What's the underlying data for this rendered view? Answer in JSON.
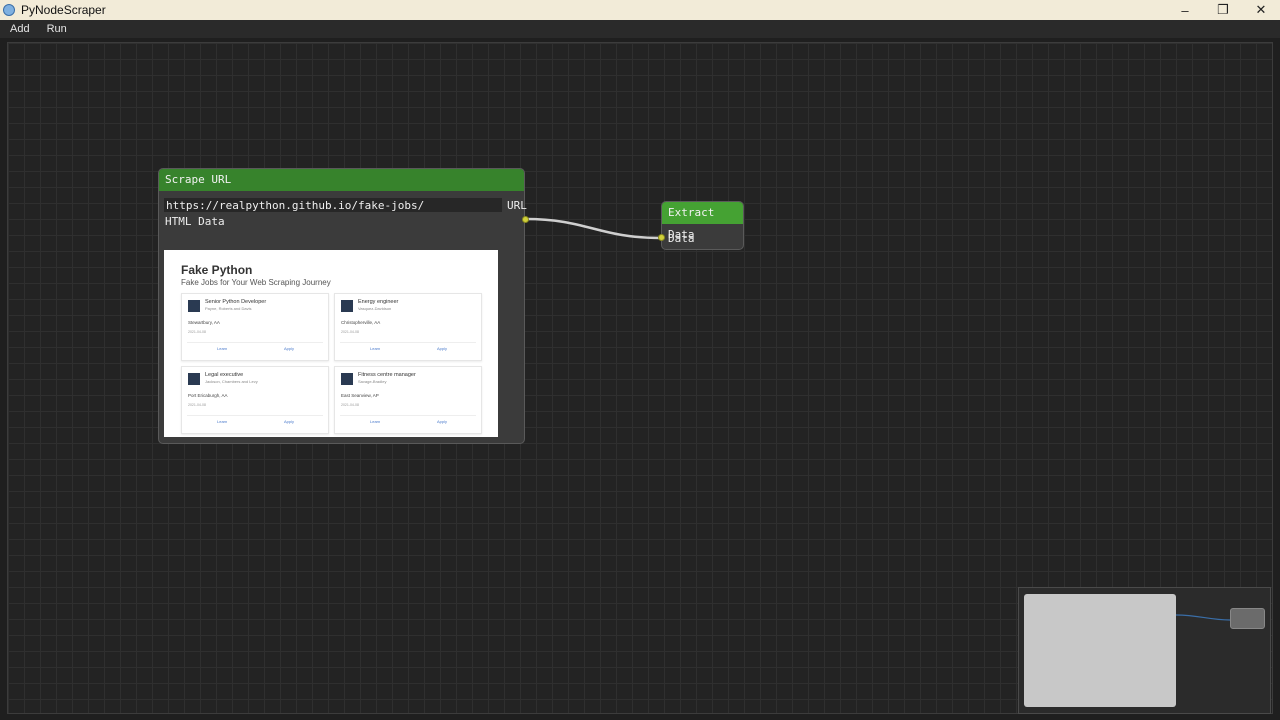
{
  "window": {
    "title": "PyNodeScraper",
    "minimize": "–",
    "restore": "❐",
    "close": "✕"
  },
  "menu": {
    "items": [
      "Add",
      "Run"
    ]
  },
  "nodes": {
    "scrape": {
      "title": "Scrape URL",
      "url_value": "https://realpython.github.io/fake-jobs/",
      "url_label": "URL",
      "output_label": "HTML Data",
      "preview": {
        "title": "Fake Python",
        "subtitle": "Fake Jobs for Your Web Scraping Journey",
        "cards": [
          {
            "title": "Senior Python Developer",
            "company": "Payne, Roberts and Davis",
            "location": "Stewartbury, AA",
            "date": "2021-04-08",
            "learn": "Learn",
            "apply": "Apply"
          },
          {
            "title": "Energy engineer",
            "company": "Vasquez-Davidson",
            "location": "Christopherville, AA",
            "date": "2021-04-08",
            "learn": "Learn",
            "apply": "Apply"
          },
          {
            "title": "Legal executive",
            "company": "Jackson, Chambers and Levy",
            "location": "Port Ericaburgh, AA",
            "date": "2021-04-08",
            "learn": "Learn",
            "apply": "Apply"
          },
          {
            "title": "Fitness centre manager",
            "company": "Savage-Bradley",
            "location": "East Seanview, AP",
            "date": "2021-04-08",
            "learn": "Learn",
            "apply": "Apply"
          }
        ]
      }
    },
    "extract": {
      "title": "Extract Data",
      "input_label": "Data"
    }
  },
  "colors": {
    "scrape_header": "#37832c",
    "extract_header": "#45a233",
    "pin": "#d0d03a",
    "link": "#cfcfcf",
    "minimap_link": "#3a6ea8"
  },
  "icons": {
    "app": "app-icon",
    "minimize": "minimize-icon",
    "restore": "restore-icon",
    "close": "close-icon"
  }
}
